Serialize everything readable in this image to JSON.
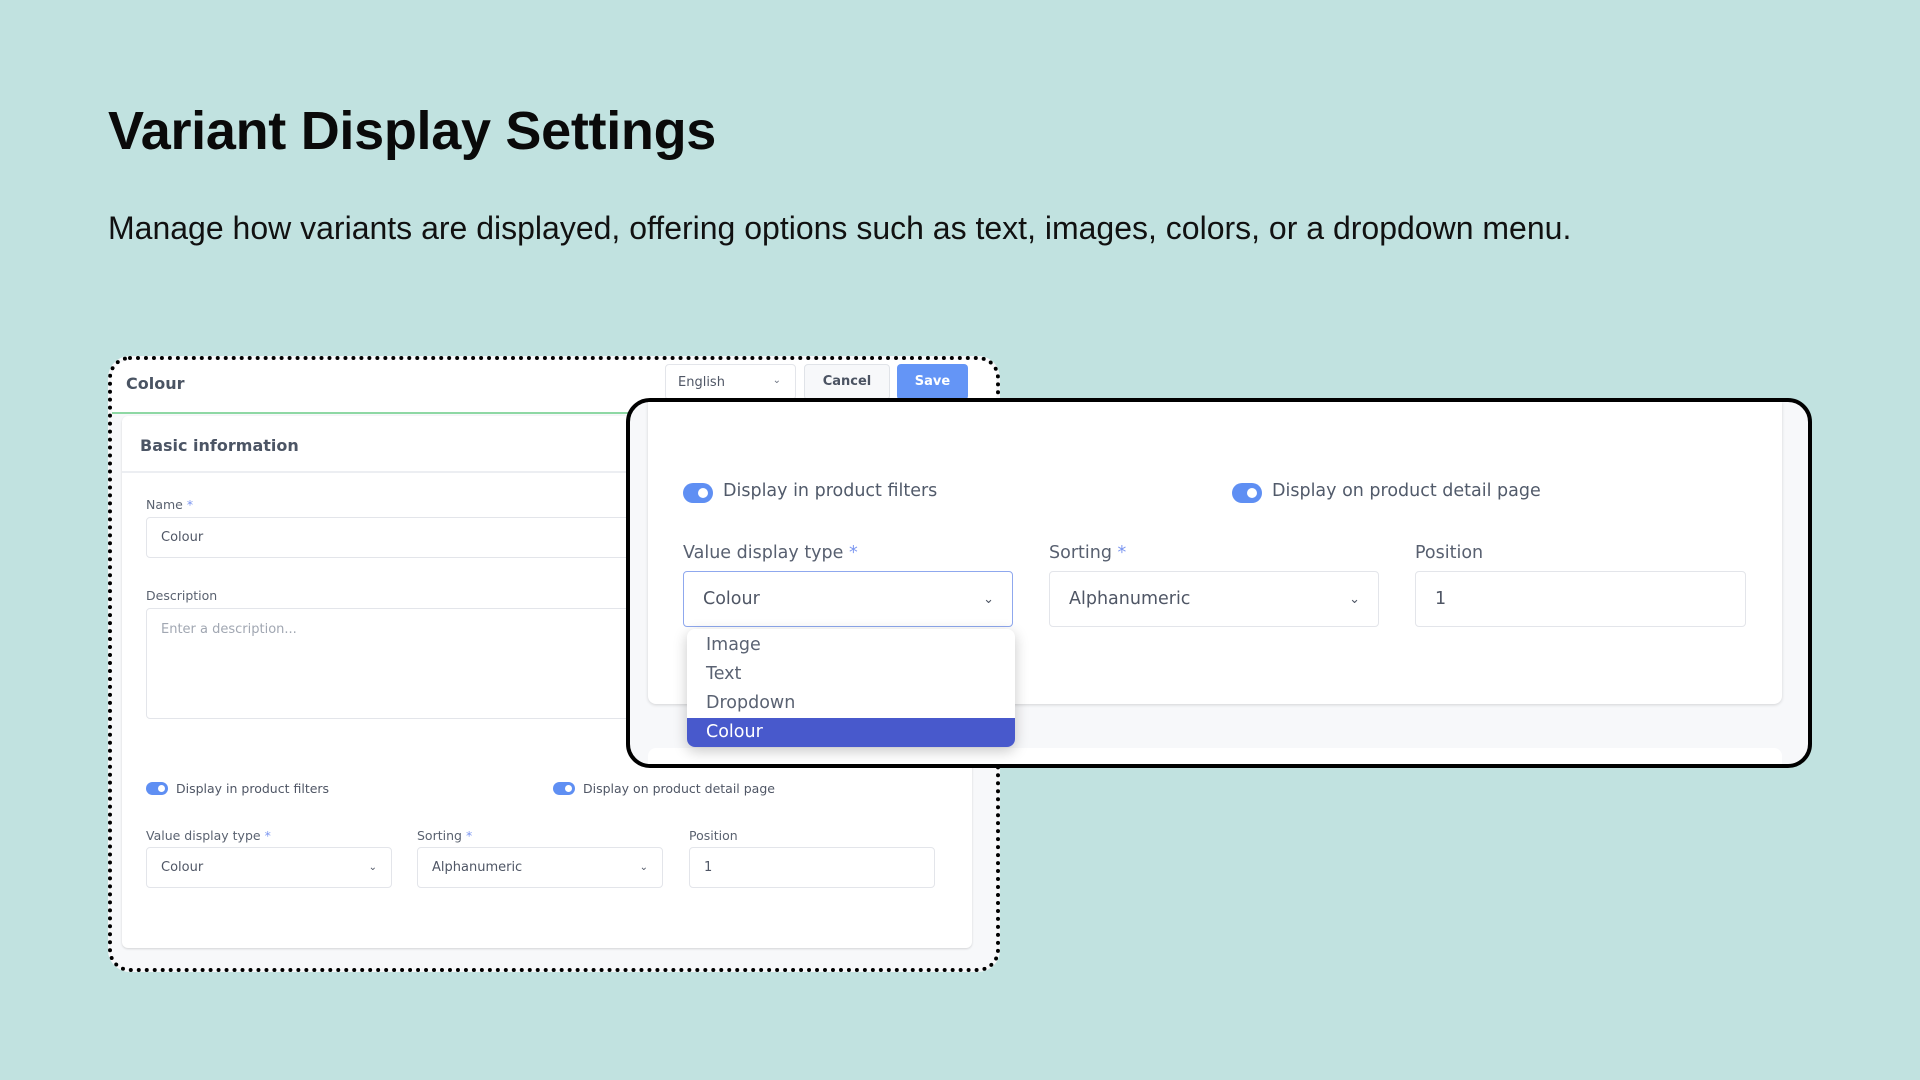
{
  "page": {
    "title": "Variant Display Settings",
    "subtitle": "Manage how variants are displayed, offering options such as text, images, colors, or a dropdown menu."
  },
  "colors": {
    "background": "#c1e2e0",
    "accent_blue": "#6495f6",
    "selected_option": "#4859cc",
    "saved_line": "#8ed8a4"
  },
  "editor": {
    "header": {
      "title": "Colour",
      "language": "English",
      "cancel_label": "Cancel",
      "save_label": "Save"
    },
    "basic_info": {
      "section_title": "Basic information",
      "name_label": "Name",
      "name_value": "Colour",
      "description_label": "Description",
      "description_placeholder": "Enter a description..."
    },
    "toggles": [
      {
        "label": "Display in product filters",
        "on": true
      },
      {
        "label": "Display on product detail page",
        "on": true
      }
    ],
    "fields": {
      "value_display_type": {
        "label": "Value display type",
        "value": "Colour",
        "required": "*"
      },
      "sorting": {
        "label": "Sorting",
        "value": "Alphanumeric",
        "required": "*"
      },
      "position": {
        "label": "Position",
        "value": "1"
      }
    },
    "required_marker": "*"
  },
  "zoomed_panel": {
    "toggles": [
      {
        "label": "Display in product filters",
        "on": true
      },
      {
        "label": "Display on product detail page",
        "on": true
      }
    ],
    "fields": {
      "value_display_type": {
        "label": "Value display type",
        "value": "Colour"
      },
      "sorting": {
        "label": "Sorting",
        "value": "Alphanumeric"
      },
      "position": {
        "label": "Position",
        "value": "1"
      }
    },
    "dropdown_options": [
      {
        "label": "Image",
        "selected": false
      },
      {
        "label": "Text",
        "selected": false
      },
      {
        "label": "Dropdown",
        "selected": false
      },
      {
        "label": "Colour",
        "selected": true
      }
    ]
  },
  "icons": {
    "chevron": "⌄"
  }
}
